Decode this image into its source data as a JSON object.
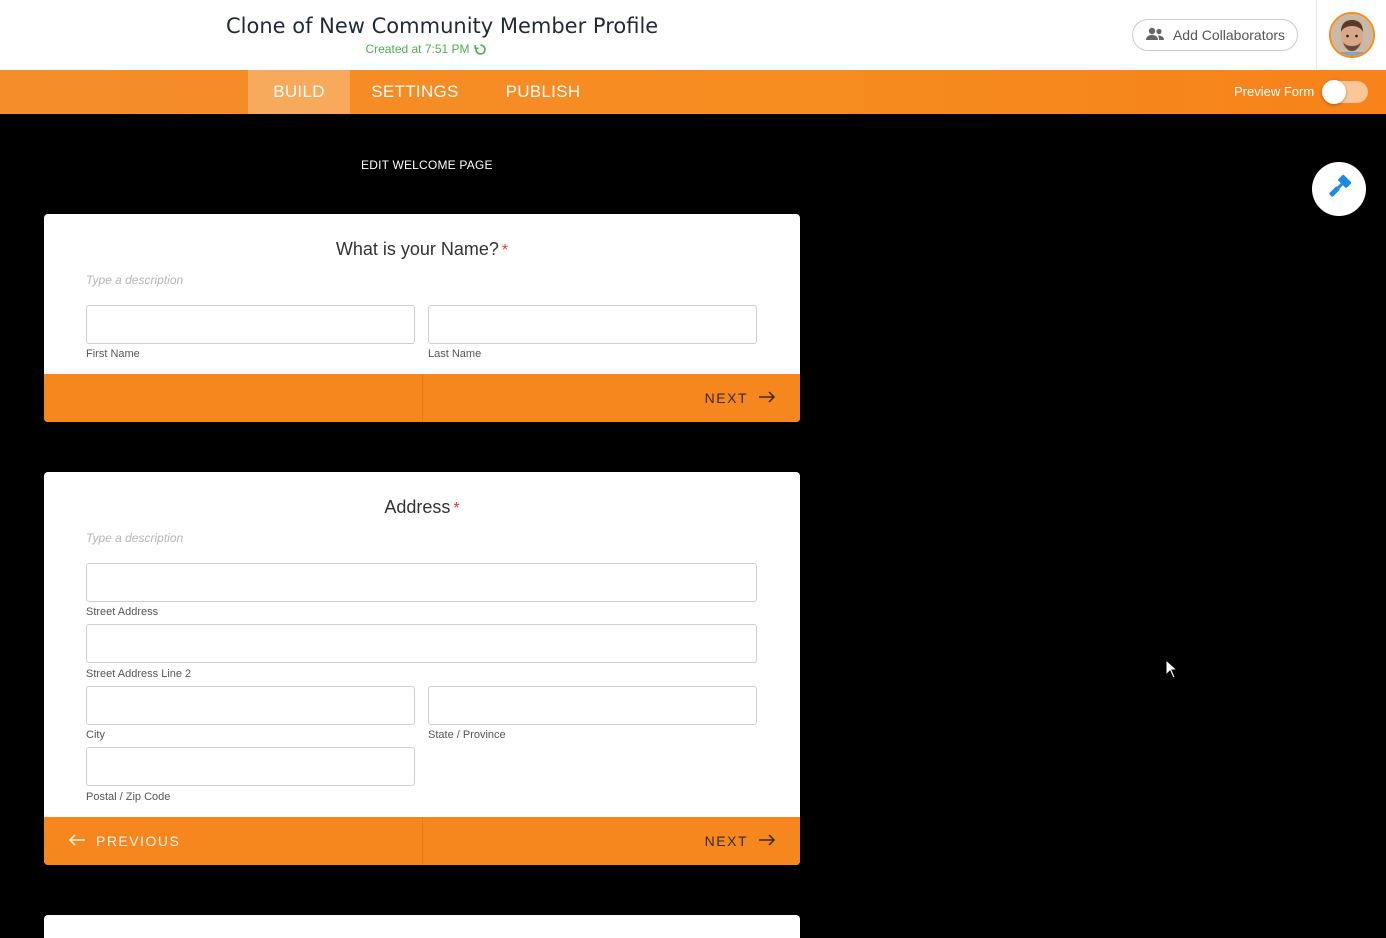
{
  "header": {
    "form_title": "Clone of New Community Member Profile",
    "created_text": "Created at 7:51 PM",
    "add_collaborators_label": "Add Collaborators"
  },
  "nav": {
    "tabs": [
      {
        "label": "BUILD",
        "active": true
      },
      {
        "label": "SETTINGS",
        "active": false
      },
      {
        "label": "PUBLISH",
        "active": false
      }
    ],
    "preview_label": "Preview Form",
    "preview_on": false
  },
  "edit_welcome_label": "EDIT WELCOME PAGE",
  "card_name": {
    "question": "What is your Name?",
    "required_mark": "*",
    "description_placeholder": "Type a description",
    "first_name_label": "First Name",
    "last_name_label": "Last Name",
    "next_label": "NEXT"
  },
  "card_address": {
    "question": "Address",
    "required_mark": "*",
    "description_placeholder": "Type a description",
    "street_label": "Street Address",
    "street2_label": "Street Address Line 2",
    "city_label": "City",
    "state_label": "State / Province",
    "postal_label": "Postal / Zip Code",
    "previous_label": "PREVIOUS",
    "next_label": "NEXT"
  },
  "colors": {
    "accent_orange": "#f68b1f",
    "created_green": "#4caf50",
    "required_red": "#e53935",
    "fab_blue": "#1e88e5"
  },
  "icons": {
    "refresh": "refresh-icon",
    "collaborators": "users-icon",
    "next": "arrow-right-icon",
    "previous": "arrow-left-icon",
    "fab": "paint-roller-icon"
  }
}
